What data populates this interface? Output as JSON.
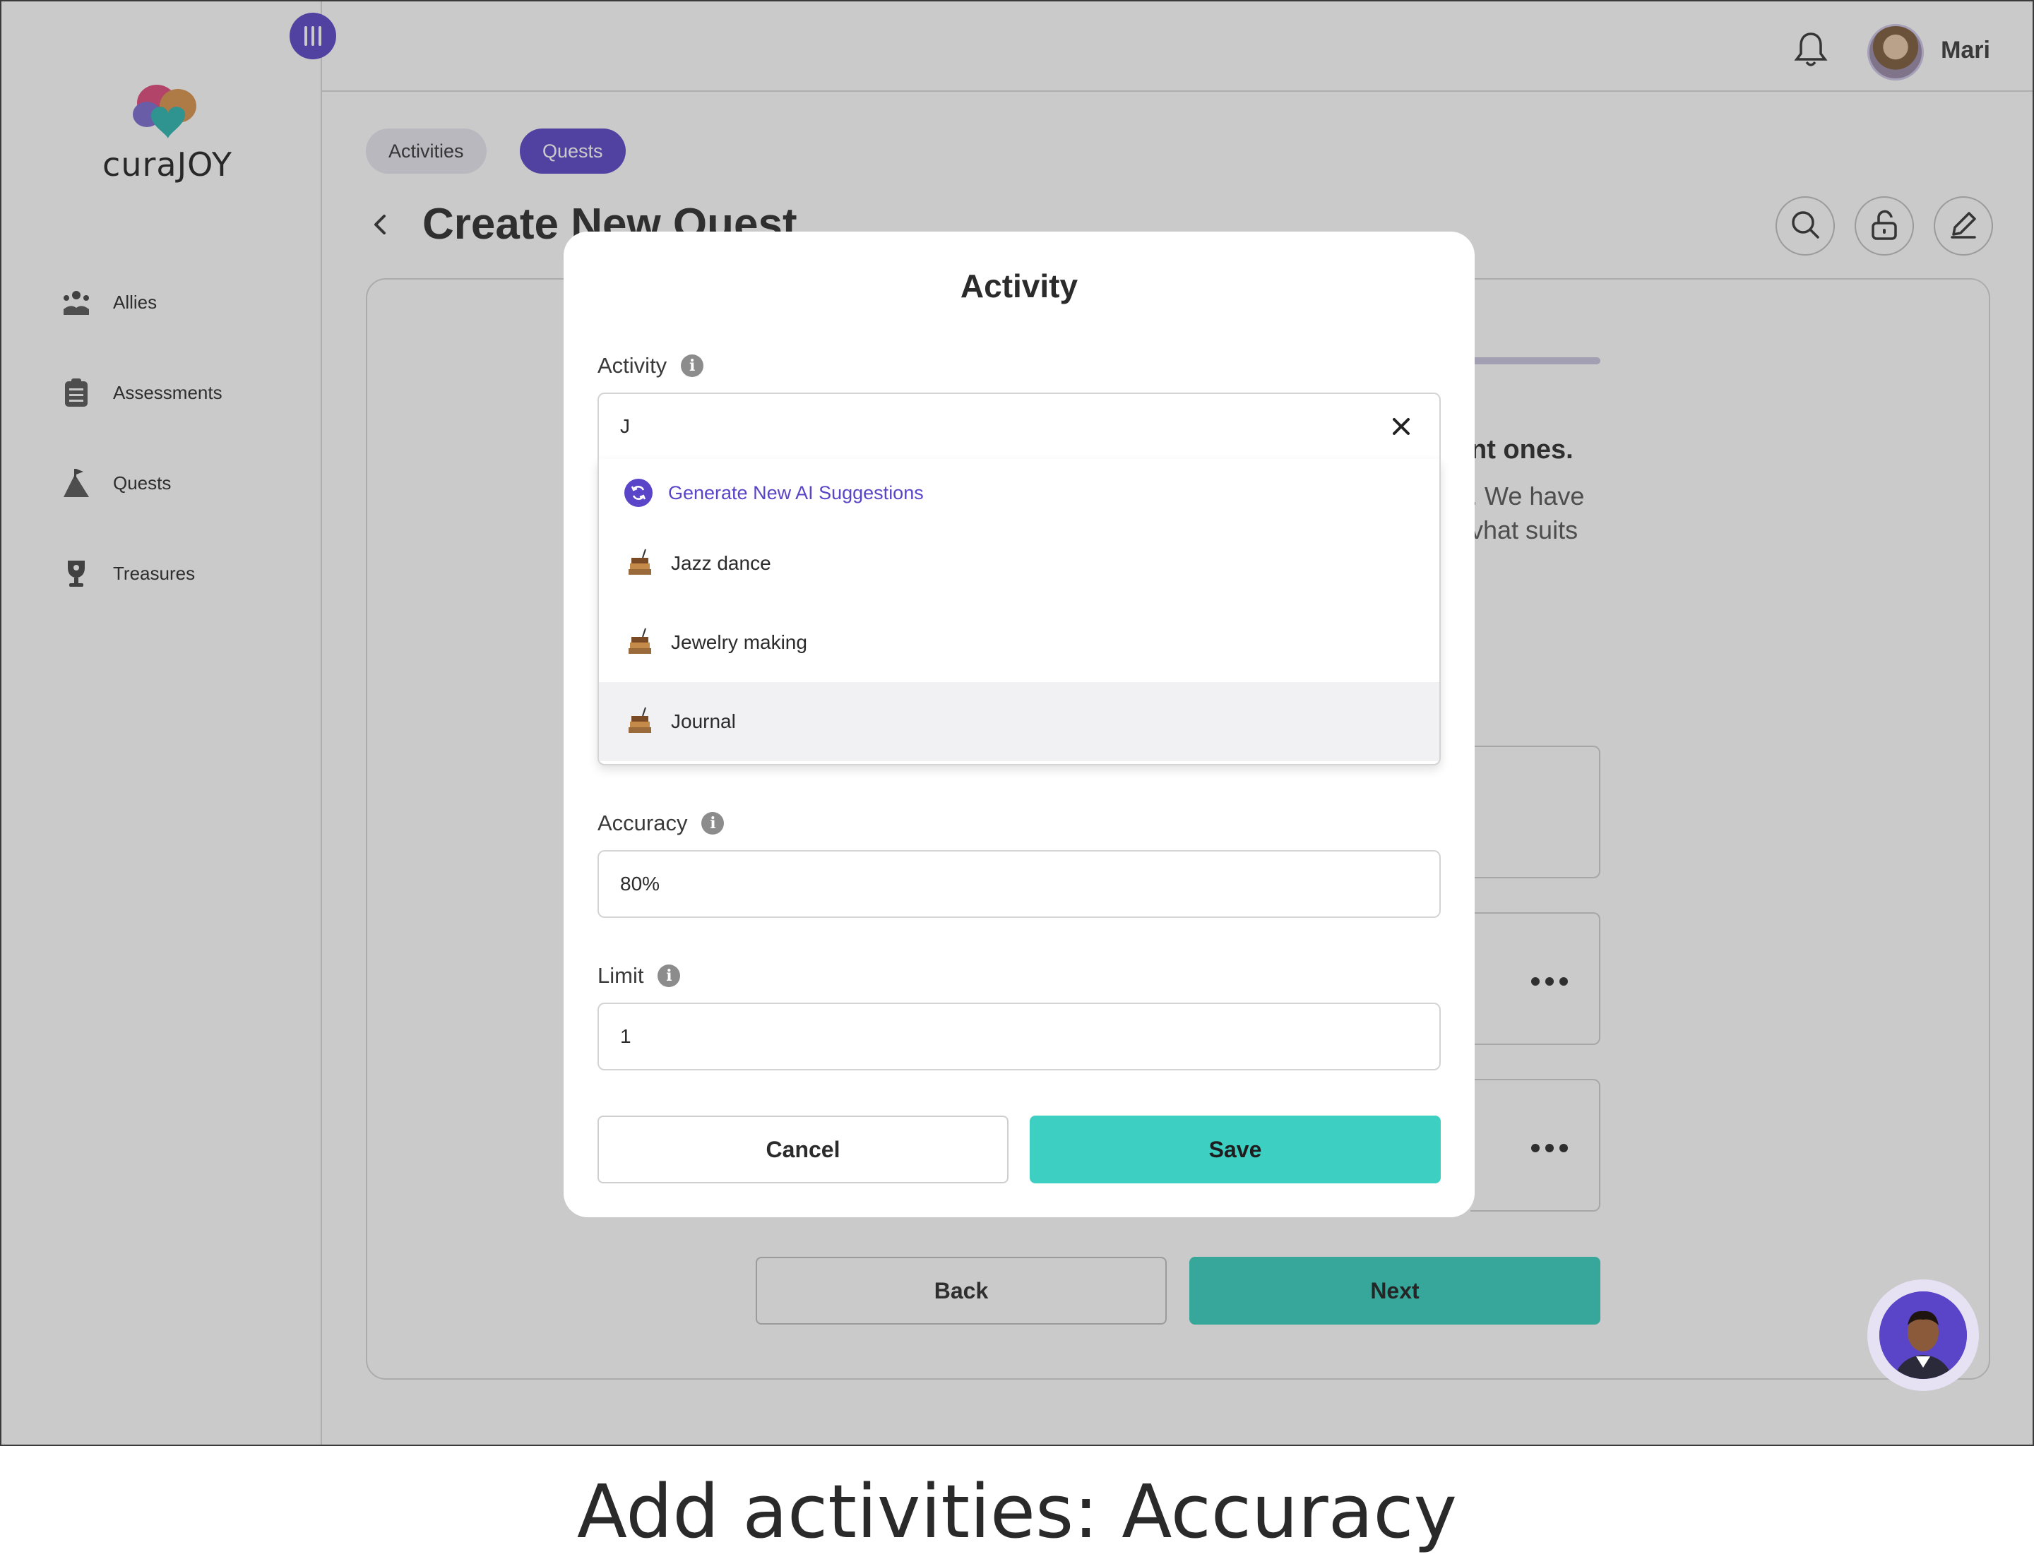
{
  "app": {
    "brand": "curaJOY",
    "user_name": "Mari"
  },
  "sidebar": {
    "items": [
      {
        "label": "Allies",
        "icon": "allies-icon"
      },
      {
        "label": "Assessments",
        "icon": "clipboard-icon"
      },
      {
        "label": "Quests",
        "icon": "mountain-flag-icon"
      },
      {
        "label": "Treasures",
        "icon": "trophy-icon"
      }
    ]
  },
  "header": {
    "tabs": [
      {
        "label": "Activities",
        "active": false
      },
      {
        "label": "Quests",
        "active": true
      }
    ],
    "page_title": "Create New Quest"
  },
  "background": {
    "heading_fragment": "nt ones.",
    "line1_fragment": ".  We have",
    "line2_fragment": "vhat suits",
    "back_label": "Back",
    "next_label": "Next"
  },
  "modal": {
    "title": "Activity",
    "activity": {
      "label": "Activity",
      "value": "J"
    },
    "dropdown": {
      "ai_suggestion": "Generate New AI Suggestions",
      "options": [
        "Jazz dance",
        "Jewelry making",
        "Journal"
      ],
      "highlighted": "Journal"
    },
    "accuracy": {
      "label": "Accuracy",
      "value": "80%"
    },
    "limit": {
      "label": "Limit",
      "value": "1"
    },
    "cancel_label": "Cancel",
    "save_label": "Save"
  },
  "caption": "Add activities: Accuracy",
  "colors": {
    "brand_purple": "#5a45c9",
    "teal": "#3dcfc1"
  }
}
